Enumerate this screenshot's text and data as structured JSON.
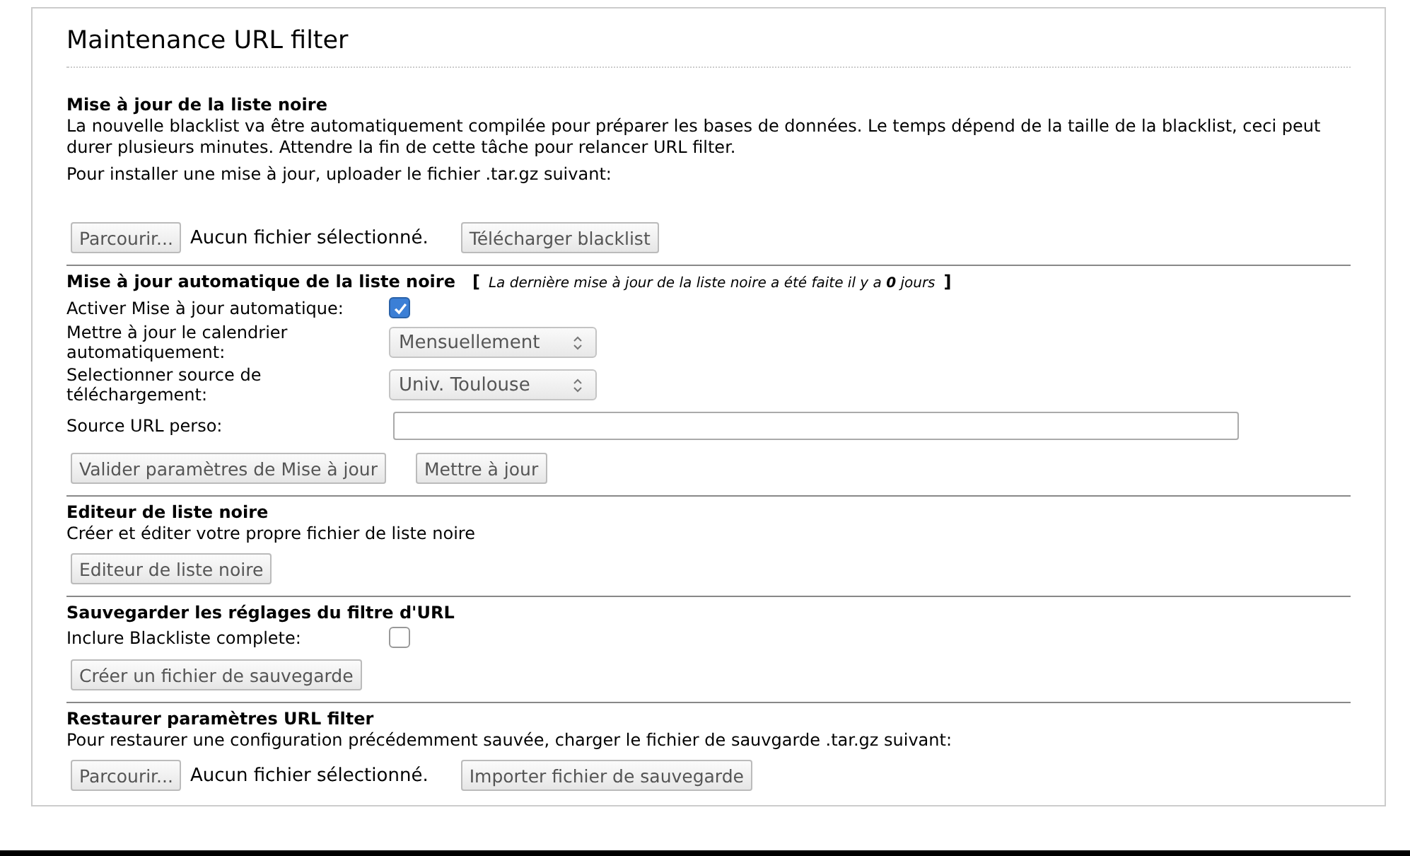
{
  "title": "Maintenance URL filter",
  "sections": [
    {
      "heading": "Mise à jour de la liste noire",
      "paragraphs": [
        "La nouvelle blacklist va être automatiquement compilée pour préparer les bases de données. Le temps dépend de la taille de la blacklist, ceci peut durer plusieurs minutes. Attendre la fin de cette tâche pour relancer URL filter.",
        "Pour installer une mise à jour, uploader le fichier .tar.gz suivant:"
      ],
      "actions": [
        {
          "kind": "file",
          "button": "Parcourir...",
          "status": "Aucun fichier sélectionné."
        },
        {
          "kind": "button",
          "label": "Télécharger blacklist"
        }
      ]
    },
    {
      "heading": "Mise à jour automatique de la liste noire",
      "note": {
        "open": "[",
        "text": "La dernière mise à jour de la liste noire a été faite il y a **0** jours",
        "close": "]"
      },
      "fields": [
        {
          "kind": "checkbox",
          "label": "Activer Mise à jour automatique:",
          "checked": true
        },
        {
          "kind": "select",
          "label": "Mettre à jour le calendrier automatiquement:",
          "value": "Mensuellement"
        },
        {
          "kind": "select",
          "label": "Selectionner source de téléchargement:",
          "value": "Univ. Toulouse"
        },
        {
          "kind": "text",
          "label": "Source URL perso:"
        }
      ],
      "actions": [
        {
          "kind": "button",
          "label": "Valider paramètres de Mise à jour"
        },
        {
          "kind": "button",
          "label": "Mettre à jour"
        }
      ]
    },
    {
      "heading": "Editeur de liste noire",
      "paragraphs": [
        "Créer et éditer votre propre fichier de liste noire"
      ],
      "actions": [
        {
          "kind": "button",
          "label": "Editeur de liste noire"
        }
      ]
    },
    {
      "heading": "Sauvegarder les réglages du filtre d'URL",
      "fields": [
        {
          "kind": "checkbox",
          "label": "Inclure Blackliste complete:",
          "checked": false
        }
      ],
      "actions": [
        {
          "kind": "button",
          "label": "Créer un fichier de sauvegarde"
        }
      ]
    },
    {
      "heading": "Restaurer paramètres URL filter",
      "paragraphs": [
        "Pour restaurer une configuration précédemment sauvée, charger le fichier de sauvgarde .tar.gz suivant:"
      ],
      "actions": [
        {
          "kind": "file",
          "button": "Parcourir...",
          "status": "Aucun fichier sélectionné."
        },
        {
          "kind": "button",
          "label": "Importer fichier de sauvegarde"
        }
      ]
    }
  ]
}
